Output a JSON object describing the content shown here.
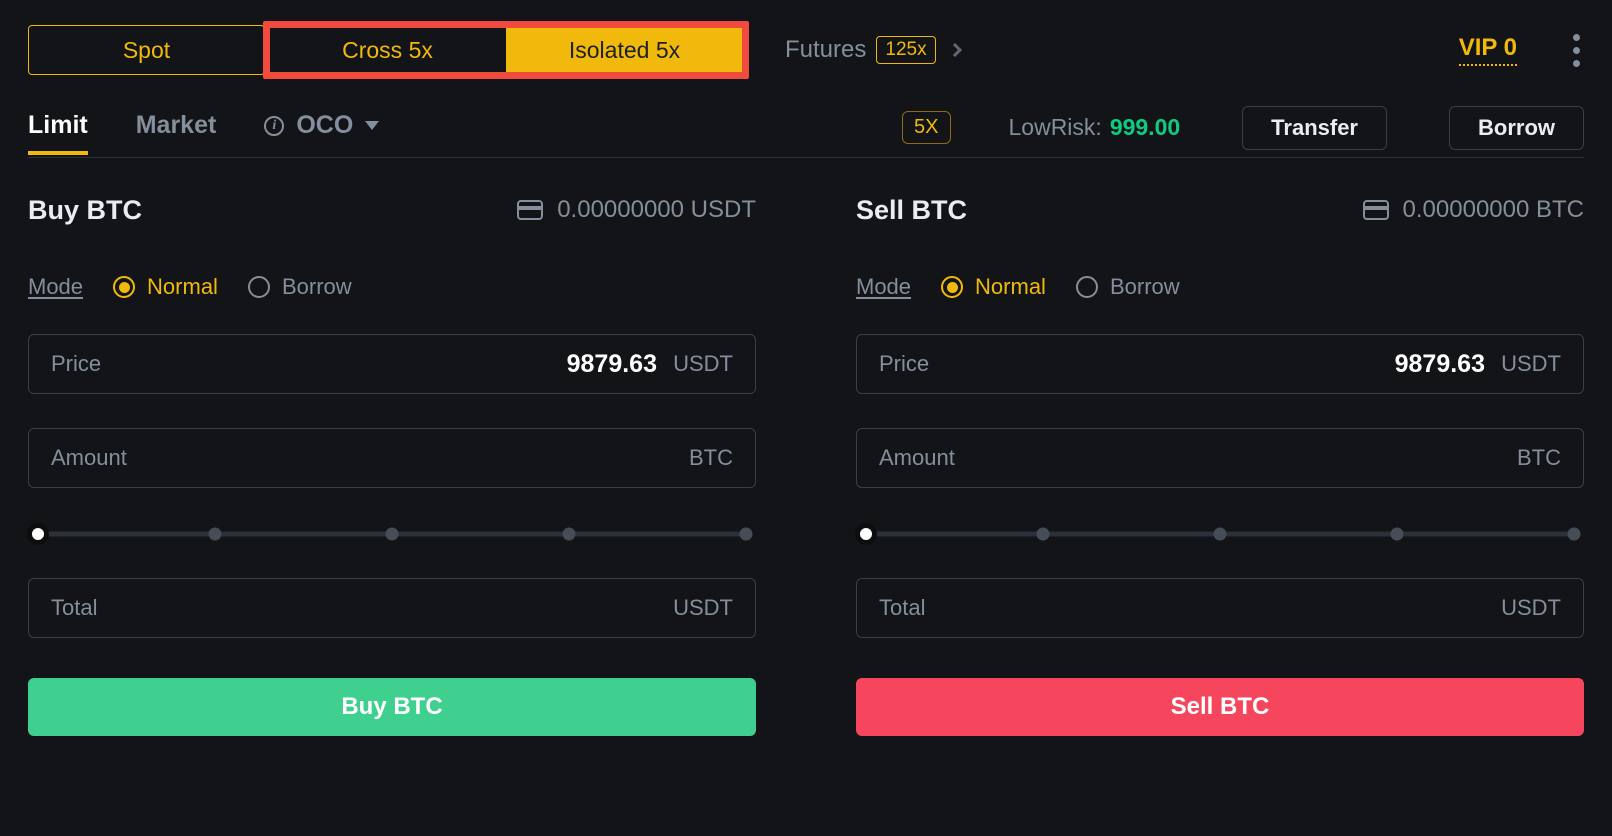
{
  "top": {
    "spot": "Spot",
    "cross": "Cross 5x",
    "isolated": "Isolated 5x",
    "futures_label": "Futures",
    "futures_badge": "125x",
    "vip": "VIP 0"
  },
  "tabs": {
    "limit": "Limit",
    "market": "Market",
    "oco": "OCO"
  },
  "risk": {
    "lev_badge": "5X",
    "label": "LowRisk:",
    "value": "999.00",
    "transfer": "Transfer",
    "borrow": "Borrow"
  },
  "buy": {
    "title": "Buy BTC",
    "balance": "0.00000000 USDT",
    "mode_label": "Mode",
    "mode_normal": "Normal",
    "mode_borrow": "Borrow",
    "price_label": "Price",
    "price_value": "9879.63",
    "price_unit": "USDT",
    "amount_label": "Amount",
    "amount_value": "",
    "amount_unit": "BTC",
    "total_label": "Total",
    "total_value": "",
    "total_unit": "USDT",
    "submit": "Buy BTC"
  },
  "sell": {
    "title": "Sell BTC",
    "balance": "0.00000000 BTC",
    "mode_label": "Mode",
    "mode_normal": "Normal",
    "mode_borrow": "Borrow",
    "price_label": "Price",
    "price_value": "9879.63",
    "price_unit": "USDT",
    "amount_label": "Amount",
    "amount_value": "",
    "amount_unit": "BTC",
    "total_label": "Total",
    "total_value": "",
    "total_unit": "USDT",
    "submit": "Sell BTC"
  }
}
